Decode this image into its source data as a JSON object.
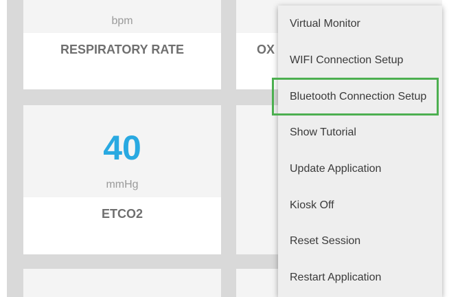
{
  "tiles": {
    "respiratory": {
      "unit": "bpm",
      "label": "RESPIRATORY RATE"
    },
    "oxygen": {
      "label_partial": "OX"
    },
    "etco2": {
      "value": "40",
      "unit": "mmHg",
      "label": "ETCO2"
    }
  },
  "menu": {
    "items": [
      {
        "label": "Virtual Monitor"
      },
      {
        "label": "WIFI Connection Setup"
      },
      {
        "label": "Bluetooth Connection Setup"
      },
      {
        "label": "Show Tutorial"
      },
      {
        "label": "Update Application"
      },
      {
        "label": "Kiosk Off"
      },
      {
        "label": "Reset Session"
      },
      {
        "label": "Restart Application"
      }
    ],
    "highlighted_index": 2,
    "highlight_color": "#4caf50"
  },
  "colors": {
    "value_accent": "#29a9e1",
    "grid_background": "#d9d9d9"
  }
}
